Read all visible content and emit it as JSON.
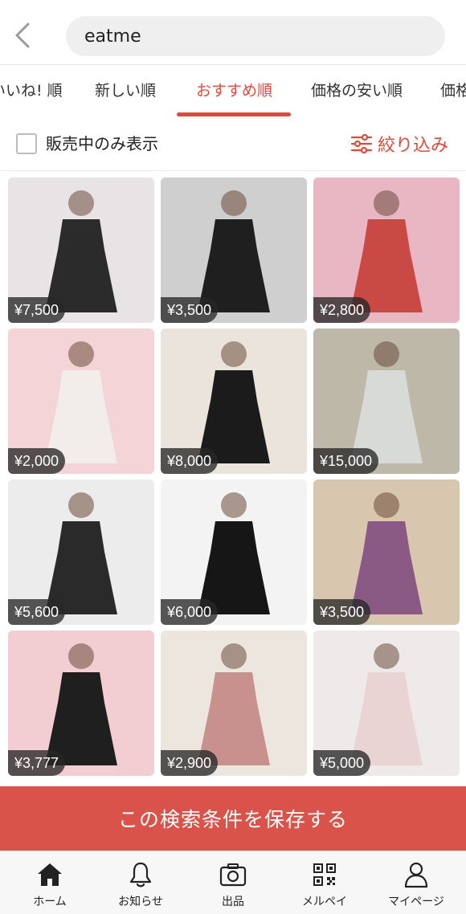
{
  "search": {
    "query": "eatme"
  },
  "tabs": [
    {
      "label": "いいね! 順"
    },
    {
      "label": "新しい順"
    },
    {
      "label": "おすすめ順",
      "active": true
    },
    {
      "label": "価格の安い順"
    },
    {
      "label": "価格"
    }
  ],
  "filter": {
    "on_sale_only_label": "販売中のみ表示",
    "on_sale_only_checked": false,
    "refine_label": "絞り込み"
  },
  "products": [
    {
      "price": "¥7,500",
      "tone": "#2b2b2b",
      "bg": "#e8e4e6"
    },
    {
      "price": "¥3,500",
      "tone": "#1f1f1f",
      "bg": "#cfcfcf"
    },
    {
      "price": "¥2,800",
      "tone": "#c94a45",
      "bg": "#e9b6c4"
    },
    {
      "price": "¥2,000",
      "tone": "#f2ecea",
      "bg": "#f4d4d6"
    },
    {
      "price": "¥8,000",
      "tone": "#1b1b1b",
      "bg": "#eae4dd"
    },
    {
      "price": "¥15,000",
      "tone": "#d7dad6",
      "bg": "#bdb8a9"
    },
    {
      "price": "¥5,600",
      "tone": "#2a2a2a",
      "bg": "#ececec"
    },
    {
      "price": "¥6,000",
      "tone": "#161616",
      "bg": "#f3f3f3"
    },
    {
      "price": "¥3,500",
      "tone": "#8b5a84",
      "bg": "#d9c6ae"
    },
    {
      "price": "¥3,777",
      "tone": "#1f1f1f",
      "bg": "#f2cdd1"
    },
    {
      "price": "¥2,900",
      "tone": "#c9918d",
      "bg": "#ece6df"
    },
    {
      "price": "¥5,000",
      "tone": "#e9d3d3",
      "bg": "#efeaea"
    }
  ],
  "save_search": {
    "label": "この検索条件を保存する"
  },
  "bottom_nav": [
    {
      "label": "ホーム",
      "icon": "home-icon"
    },
    {
      "label": "お知らせ",
      "icon": "bell-icon"
    },
    {
      "label": "出品",
      "icon": "camera-icon"
    },
    {
      "label": "メルペイ",
      "icon": "qr-code-icon"
    },
    {
      "label": "マイページ",
      "icon": "person-icon"
    }
  ],
  "colors": {
    "accent": "#e0483b",
    "save_bar": "#d9534a"
  }
}
